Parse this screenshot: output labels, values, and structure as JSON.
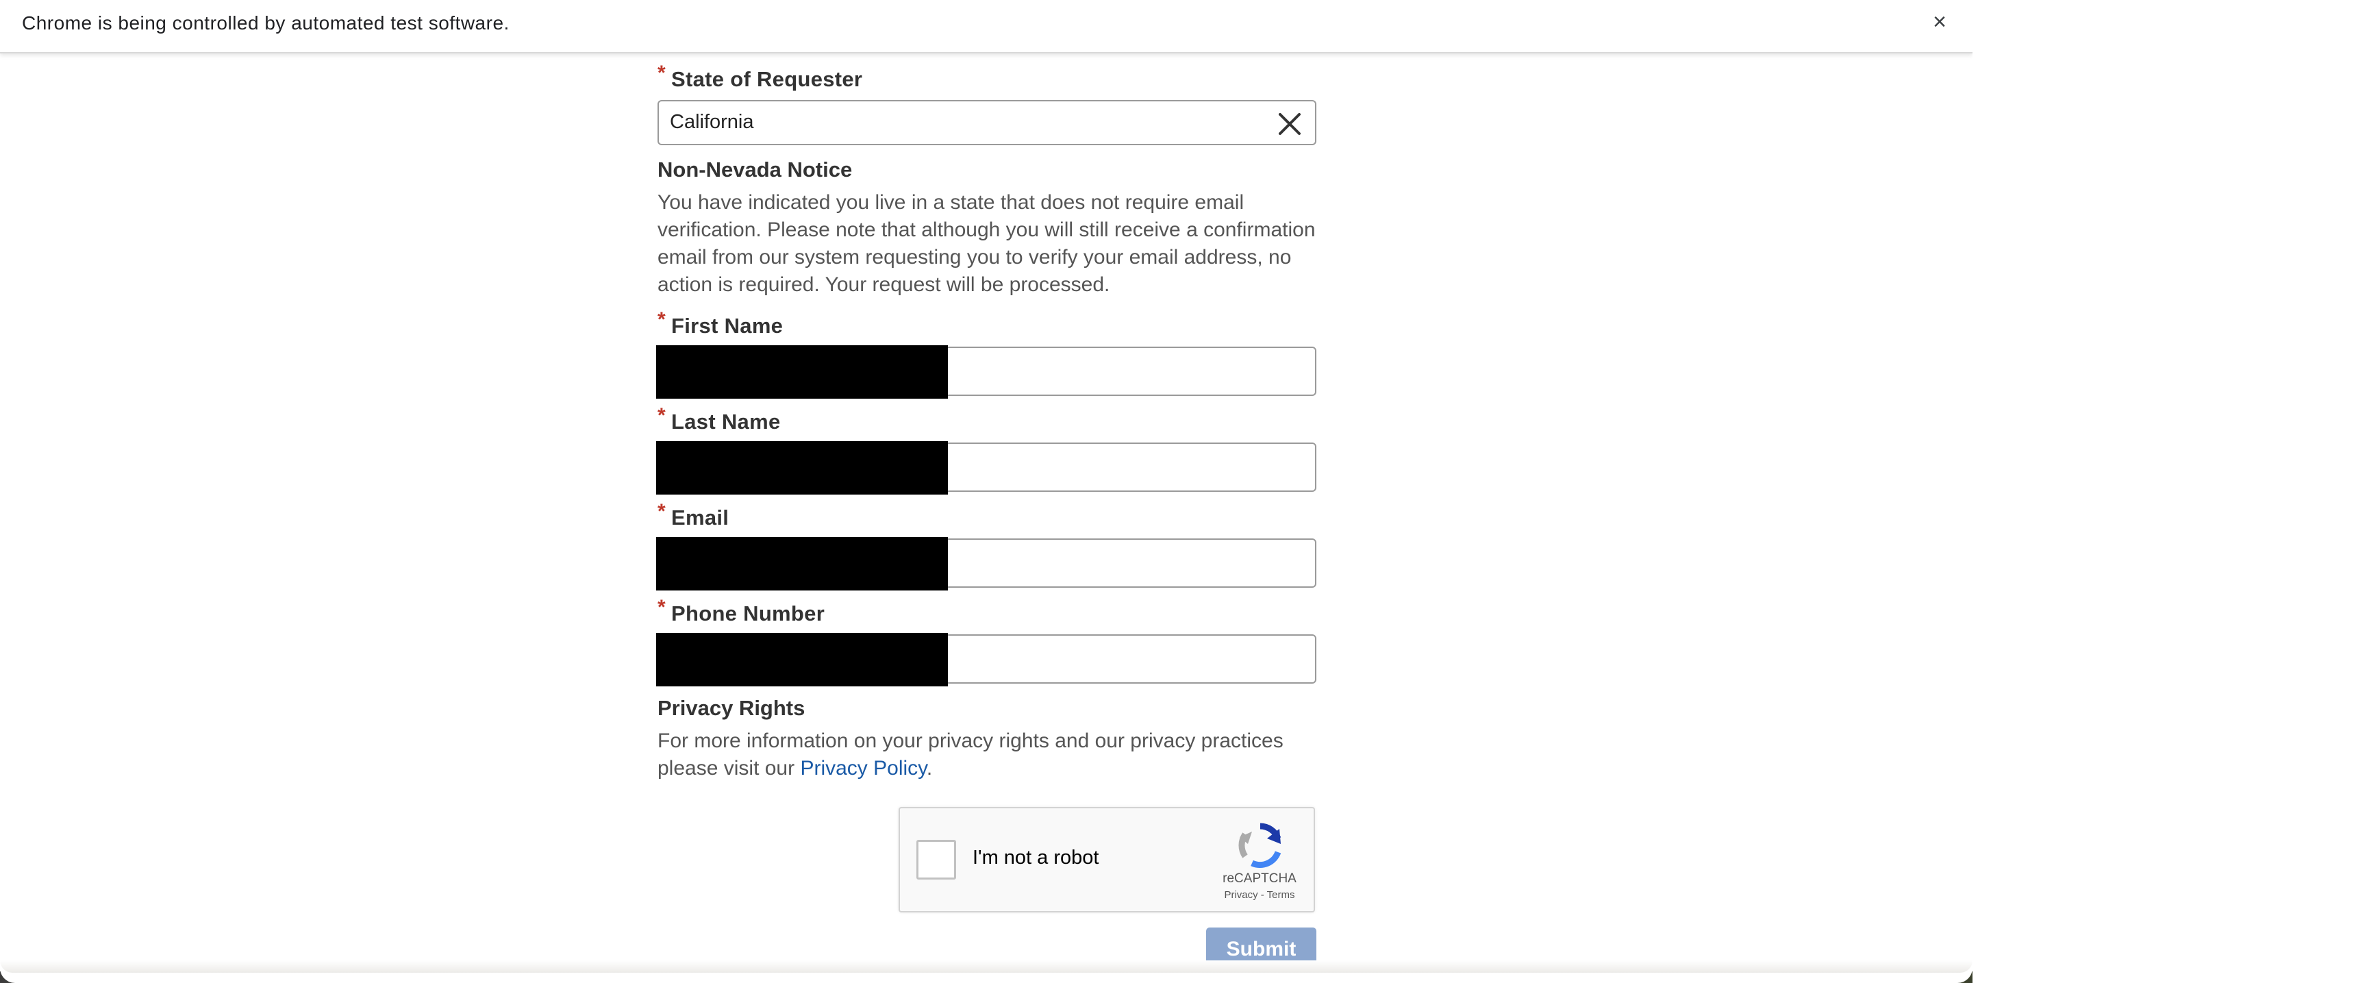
{
  "infobar": {
    "message": "Chrome is being controlled by automated test software.",
    "close_glyph": "×"
  },
  "form": {
    "required_marker": "*",
    "state": {
      "label": "State of Requester",
      "value": "California"
    },
    "notice": {
      "heading": "Non-Nevada Notice",
      "body": "You have indicated you live in a state that does not require email verification. Please note that although you will still receive a confirmation email from our system requesting you to verify your email address, no action is required. Your request will be processed."
    },
    "fields": [
      {
        "label": "First Name",
        "value": ""
      },
      {
        "label": "Last Name",
        "value": ""
      },
      {
        "label": "Email",
        "value": ""
      },
      {
        "label": "Phone Number",
        "value": ""
      }
    ],
    "privacy": {
      "heading": "Privacy Rights",
      "body_prefix": "For more information on your privacy rights and our privacy practices please visit our ",
      "link_text": "Privacy Policy",
      "body_suffix": "."
    },
    "recaptcha": {
      "label": "I'm not a robot",
      "brand": "reCAPTCHA",
      "links": "Privacy - Terms"
    },
    "submit_label": "Submit"
  },
  "colors": {
    "required_marker": "#c0392b",
    "link": "#1a5aa6",
    "submit_button_bg": "#8ba6cf",
    "redaction": "#000000"
  }
}
